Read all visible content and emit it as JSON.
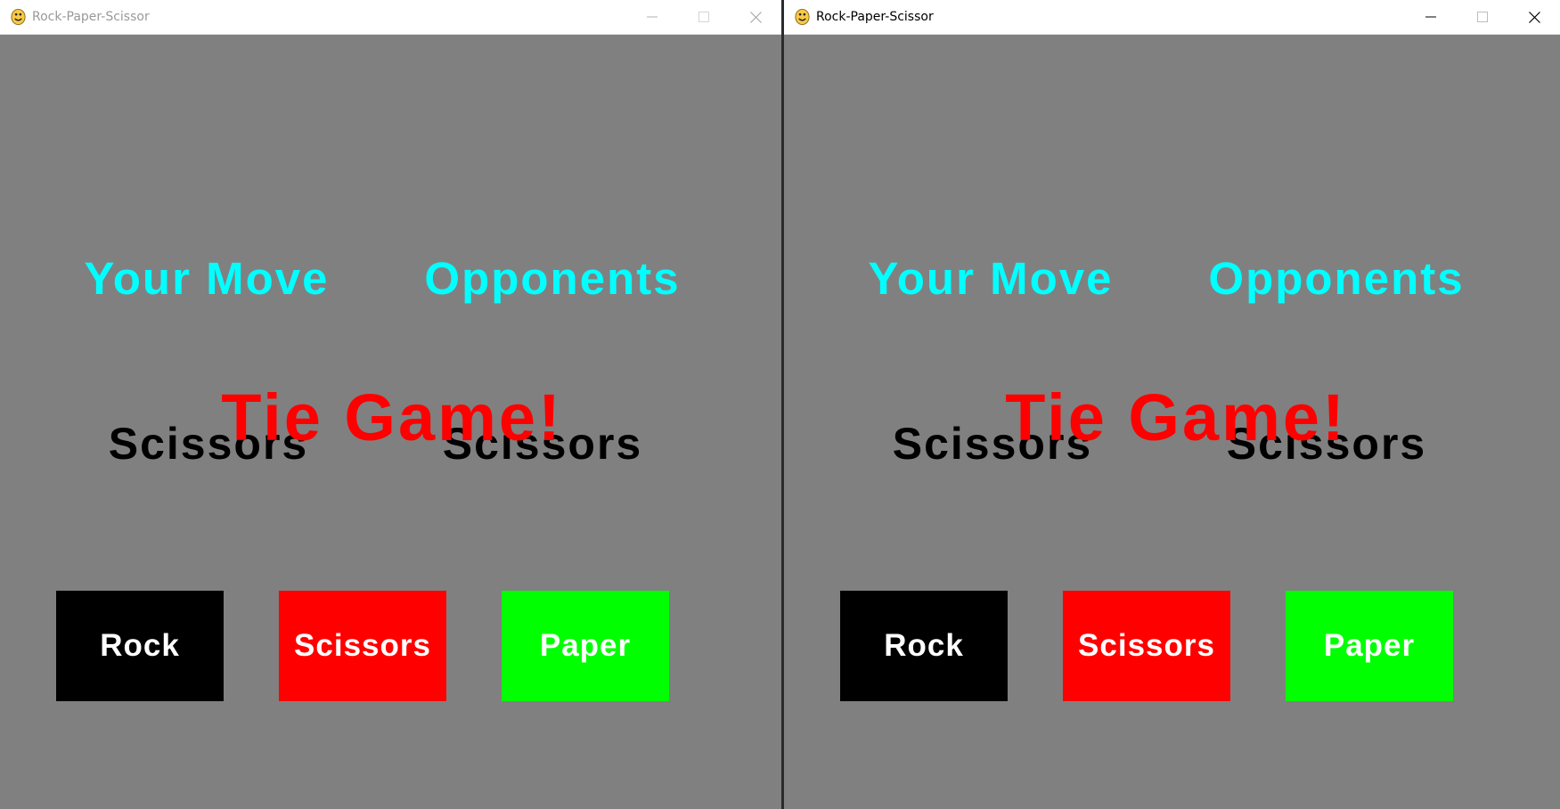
{
  "windows": [
    {
      "id": "left",
      "title": "Rock-Paper-Scissor",
      "focused": false,
      "your_move_heading": "Your Move",
      "opponents_heading": "Opponents",
      "your_move": "Scissors",
      "opponent_move": "Scissors",
      "result": "Tie Game!",
      "buttons": {
        "rock": "Rock",
        "scissors": "Scissors",
        "paper": "Paper"
      }
    },
    {
      "id": "right",
      "title": "Rock-Paper-Scissor",
      "focused": true,
      "your_move_heading": "Your Move",
      "opponents_heading": "Opponents",
      "your_move": "Scissors",
      "opponent_move": "Scissors",
      "result": "Tie Game!",
      "buttons": {
        "rock": "Rock",
        "scissors": "Scissors",
        "paper": "Paper"
      }
    }
  ],
  "colors": {
    "background": "#808080",
    "heading": "#00ffff",
    "move_text": "#000000",
    "result": "#ff0000",
    "rock_button": "#000000",
    "scissors_button": "#ff0000",
    "paper_button": "#00ff00",
    "button_text": "#ffffff"
  },
  "icons": {
    "app": "python-snake-icon",
    "minimize": "minimize-icon",
    "maximize": "maximize-icon",
    "close": "close-icon"
  }
}
